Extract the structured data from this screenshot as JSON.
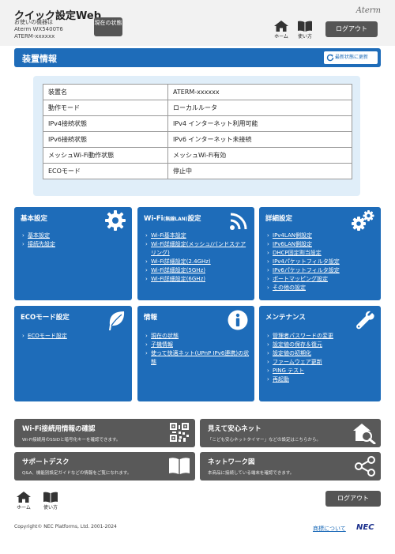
{
  "header": {
    "title": "クイック設定Web",
    "device_label": "お使いの機器は",
    "model": "Aterm WX5400T6",
    "device_name": "ATERM-xxxxxx",
    "status_button": "現在の状態",
    "brand": "Aterm",
    "home_label": "ホーム",
    "help_label": "使い方",
    "logout_label": "ログアウト"
  },
  "section": {
    "title": "装置情報",
    "refresh_label": "最新状態に更新"
  },
  "device_info": [
    {
      "key": "装置名",
      "value": "ATERM-xxxxxx"
    },
    {
      "key": "動作モード",
      "value": "ローカルルータ"
    },
    {
      "key": "IPv4接続状態",
      "value": "IPv4 インターネット利用可能"
    },
    {
      "key": "IPv6接続状態",
      "value": "IPv6 インターネット未接続"
    },
    {
      "key": "メッシュWi-Fi動作状態",
      "value": "メッシュWi-Fi有効"
    },
    {
      "key": "ECOモード",
      "value": "停止中"
    }
  ],
  "tiles": {
    "basic": {
      "title": "基本設定",
      "links": [
        "基本設定",
        "接続先設定"
      ]
    },
    "wifi": {
      "title": "Wi-Fi",
      "title_small": "(無線LAN)",
      "title_suffix": "設定",
      "links": [
        "Wi-Fi基本設定",
        "Wi-Fi詳細設定(メッシュ/バンドステアリング)",
        "Wi-Fi詳細設定(2.4GHz)",
        "Wi-Fi詳細設定(5GHz)",
        "Wi-Fi詳細設定(6GHz)"
      ]
    },
    "advanced": {
      "title": "詳細設定",
      "links": [
        "IPv4LAN側設定",
        "IPv6LAN側設定",
        "DHCP固定割当設定",
        "IPv4パケットフィルタ設定",
        "IPv6パケットフィルタ設定",
        "ポートマッピング設定",
        "その他の設定"
      ]
    },
    "eco": {
      "title": "ECOモード設定",
      "links": [
        "ECOモード設定"
      ]
    },
    "info": {
      "title": "情報",
      "links": [
        "現在の状態",
        "子機情報",
        "使って快適ネット(UPnP IPv6連携)の状態"
      ]
    },
    "maintenance": {
      "title": "メンテナンス",
      "links": [
        "管理者パスワードの変更",
        "設定値の保存＆復元",
        "設定値の初期化",
        "ファームウェア更新",
        "PING テスト",
        "再起動"
      ]
    }
  },
  "features": {
    "wifi_info": {
      "title": "Wi-Fi接続用情報の確認",
      "desc": "Wi-Fi接続用のSSIDと暗号化キーを確認できます。"
    },
    "safety": {
      "title": "見えて安心ネット",
      "desc": "「こども安心ネットタイマー」などの設定はこちらから。"
    },
    "support": {
      "title": "サポートデスク",
      "desc": "Q&A、機能別設定ガイドなどの情報をご覧になれます。"
    },
    "network_map": {
      "title": "ネットワーク図",
      "desc": "本商品に接続している端末を確認できます。"
    }
  },
  "footer": {
    "home_label": "ホーム",
    "help_label": "使い方",
    "logout_label": "ログアウト",
    "copyright": "Copyright© NEC Platforms, Ltd. 2001-2024",
    "trademark_link": "商標について",
    "nec_logo": "NEC"
  }
}
